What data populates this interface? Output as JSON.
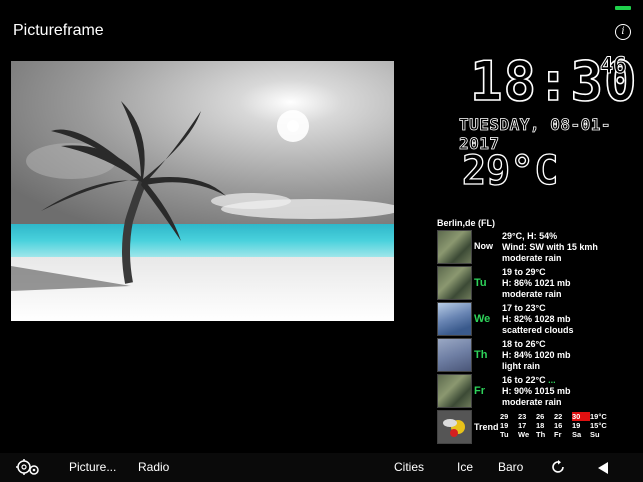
{
  "app": {
    "title": "Pictureframe",
    "info_label": "i"
  },
  "clock": {
    "time": "18:30",
    "seconds": "46",
    "date": "TUESDAY, 08-01-2017",
    "temperature": "29°C"
  },
  "weather": {
    "location": "Berlin,de (FL)",
    "rows": [
      {
        "day": "Now",
        "lines": [
          "29°C, H: 54%",
          "Wind: SW with 15 kmh",
          "moderate rain"
        ],
        "thumb": "rain"
      },
      {
        "day": "Tu",
        "lines": [
          "19 to 29°C",
          "H: 86% 1021 mb",
          "moderate rain"
        ],
        "thumb": "rain"
      },
      {
        "day": "We",
        "lines": [
          "17 to 23°C",
          "H: 82% 1028 mb",
          "scattered clouds"
        ],
        "thumb": "clouds"
      },
      {
        "day": "Th",
        "lines": [
          "18 to 26°C",
          "H: 84% 1020 mb",
          "light rain"
        ],
        "thumb": "light"
      },
      {
        "day": "Fr",
        "lines": [
          "16 to 22°C",
          "H: 90% 1015 mb",
          "moderate rain"
        ],
        "thumb": "rain",
        "more": "..."
      }
    ],
    "trend": {
      "label": "Trend",
      "highs": [
        "29",
        "23",
        "26",
        "22",
        "30",
        "19°C"
      ],
      "lows": [
        "19",
        "17",
        "18",
        "16",
        "19",
        "15°C"
      ],
      "days": [
        "Tu",
        "We",
        "Th",
        "Fr",
        "Sa",
        "Su"
      ],
      "highlight_color": "#e01010"
    }
  },
  "toolbar": {
    "settings_icon": "gears-icon",
    "picture_label": "Picture...",
    "radio_label": "Radio",
    "cities_label": "Cities",
    "ice_label": "Ice",
    "baro_label": "Baro",
    "refresh_icon": "refresh-icon",
    "back_icon": "back-triangle-icon"
  },
  "colors": {
    "accent_green": "#2ed25a",
    "battery_green": "#1fd14b",
    "background": "#000000"
  }
}
